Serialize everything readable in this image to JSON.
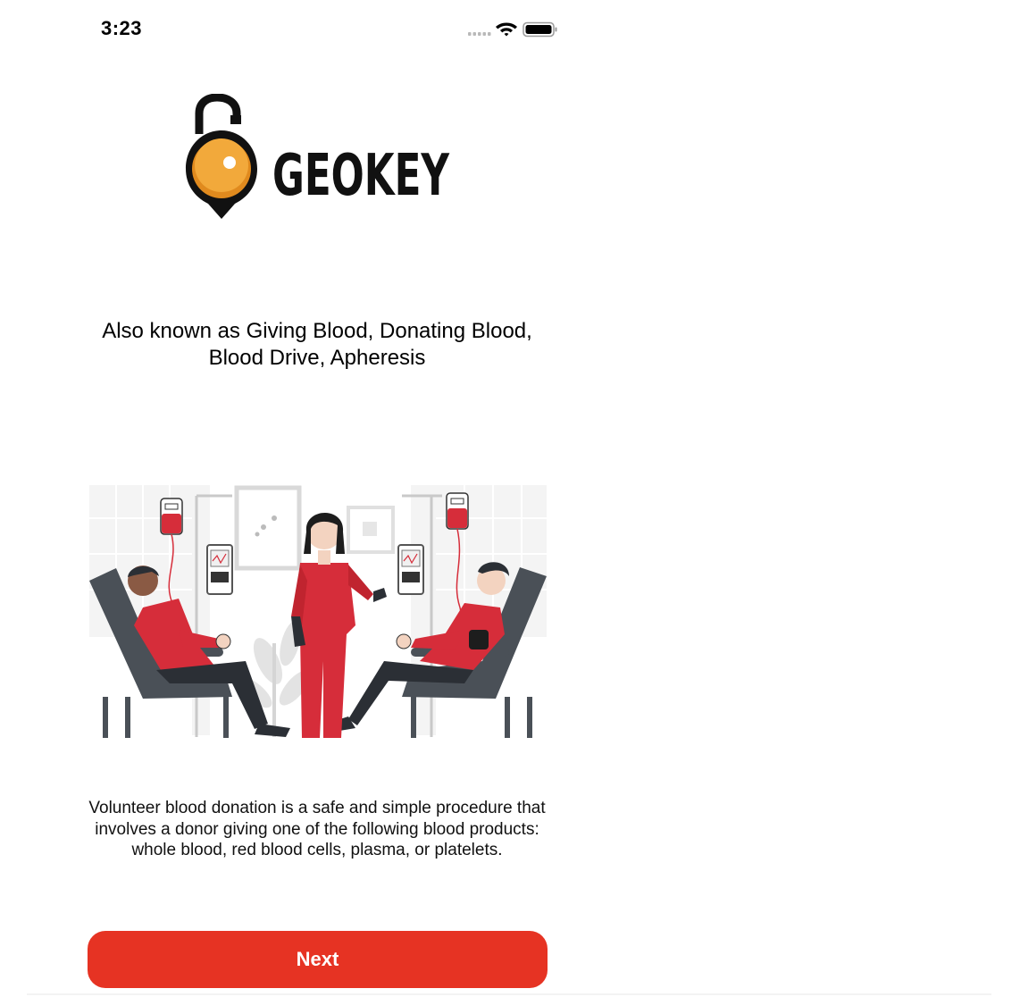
{
  "status_bar": {
    "time": "3:23"
  },
  "logo": {
    "brand_text": "GEOKEY",
    "icon": "padlock-location-pin-icon",
    "colors": {
      "shackle": "#111111",
      "pin": "#f2a93b",
      "pin_shadow": "#e08a1e"
    }
  },
  "headline": {
    "line1": "Also known as Giving Blood, Donating Blood,",
    "line2": "Blood Drive, Apheresis"
  },
  "illustration": {
    "name": "blood-donation-illustration"
  },
  "description": {
    "text": "Volunteer blood donation is a safe and simple procedure that involves a donor giving one of the following blood products: whole blood, red blood cells, plasma, or platelets."
  },
  "actions": {
    "next_label": "Next"
  },
  "colors": {
    "accent": "#e63323",
    "scrub_red": "#d62d3a",
    "chair": "#4a5057"
  }
}
